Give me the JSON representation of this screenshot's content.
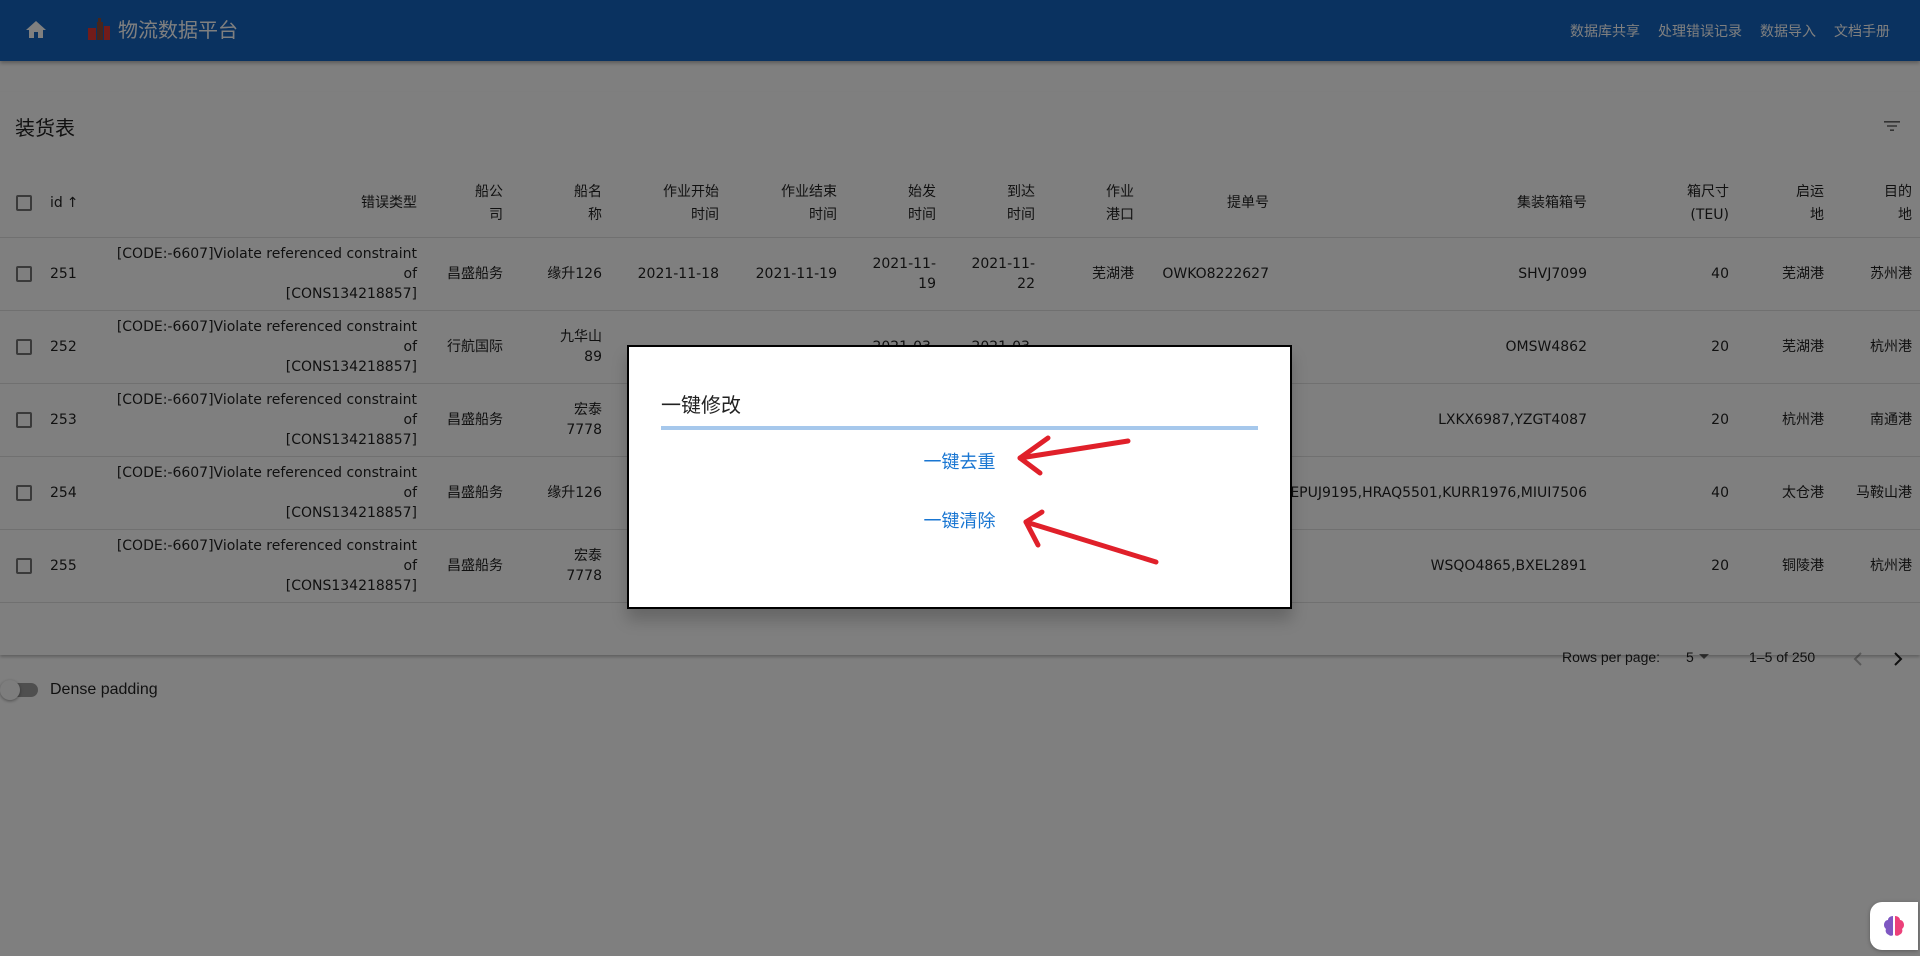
{
  "app": {
    "title": "物流数据平台"
  },
  "nav": [
    {
      "label": "数据库共享"
    },
    {
      "label": "处理错误记录"
    },
    {
      "label": "数据导入"
    },
    {
      "label": "文档手册"
    }
  ],
  "table": {
    "title": "装货表",
    "headers": {
      "id": "id",
      "error_type": "错误类型",
      "company": [
        "船公",
        "司"
      ],
      "ship": [
        "船名",
        "称"
      ],
      "start": [
        "作业开始",
        "时间"
      ],
      "end": [
        "作业结束",
        "时间"
      ],
      "depart": [
        "始发",
        "时间"
      ],
      "arrive": [
        "到达",
        "时间"
      ],
      "port": [
        "作业",
        "港口"
      ],
      "bill": "提单号",
      "container": "集装箱箱号",
      "size": [
        "箱尺寸",
        "(TEU)"
      ],
      "origin": [
        "启运",
        "地"
      ],
      "dest": [
        "目的",
        "地"
      ]
    },
    "rows": [
      {
        "id": "251",
        "error": [
          "[CODE:-6607]Violate referenced constraint of",
          "[CONS134218857]"
        ],
        "company": "昌盛船务",
        "ship": [
          "缘升126",
          ""
        ],
        "start": "2021-11-18",
        "end": "2021-11-19",
        "depart": [
          "2021-11-",
          "19"
        ],
        "arrive": [
          "2021-11-",
          "22"
        ],
        "port": "芜湖港",
        "bill": "OWKO8222627",
        "container": "SHVJ7099",
        "size": "40",
        "origin": "芜湖港",
        "dest": "苏州港"
      },
      {
        "id": "252",
        "error": [
          "[CODE:-6607]Violate referenced constraint of",
          "[CONS134218857]"
        ],
        "company": "行航国际",
        "ship": [
          "九华山",
          "89"
        ],
        "start": "",
        "end": "",
        "depart": [
          "2021-03-",
          ""
        ],
        "arrive": [
          "2021-03-",
          ""
        ],
        "port": "",
        "bill": "",
        "container": "OMSW4862",
        "size": "20",
        "origin": "芜湖港",
        "dest": "杭州港"
      },
      {
        "id": "253",
        "error": [
          "[CODE:-6607]Violate referenced constraint of",
          "[CONS134218857]"
        ],
        "company": "昌盛船务",
        "ship": [
          "宏泰",
          "7778"
        ],
        "start": "",
        "end": "",
        "depart": [
          "",
          ""
        ],
        "arrive": [
          "",
          ""
        ],
        "port": "",
        "bill": "",
        "container": "LXKX6987,YZGT4087",
        "size": "20",
        "origin": "杭州港",
        "dest": "南通港"
      },
      {
        "id": "254",
        "error": [
          "[CODE:-6607]Violate referenced constraint of",
          "[CONS134218857]"
        ],
        "company": "昌盛船务",
        "ship": [
          "缘升126",
          ""
        ],
        "start": "",
        "end": "",
        "depart": [
          "",
          ""
        ],
        "arrive": [
          "",
          ""
        ],
        "port": "",
        "bill": "",
        "container": "EPUJ9195,HRAQ5501,KURR1976,MIUI7506",
        "size": "40",
        "origin": "太仓港",
        "dest": "马鞍山港"
      },
      {
        "id": "255",
        "error": [
          "[CODE:-6607]Violate referenced constraint of",
          "[CONS134218857]"
        ],
        "company": "昌盛船务",
        "ship": [
          "宏泰",
          "7778"
        ],
        "start": "",
        "end": "",
        "depart": [
          "",
          ""
        ],
        "arrive": [
          "",
          ""
        ],
        "port": "",
        "bill": "",
        "container": "WSQO4865,BXEL2891",
        "size": "20",
        "origin": "铜陵港",
        "dest": "杭州港"
      }
    ]
  },
  "pagination": {
    "rows_per_page_label": "Rows per page:",
    "rows_per_page_value": "5",
    "range": "1–5 of 250"
  },
  "dense": {
    "label": "Dense padding"
  },
  "dialog": {
    "title": "一键修改",
    "dedupe_label": "一键去重",
    "clear_label": "一键清除"
  },
  "colors": {
    "appbar": "#1565c0",
    "link": "#1976d2",
    "arrow": "#e0202a"
  }
}
